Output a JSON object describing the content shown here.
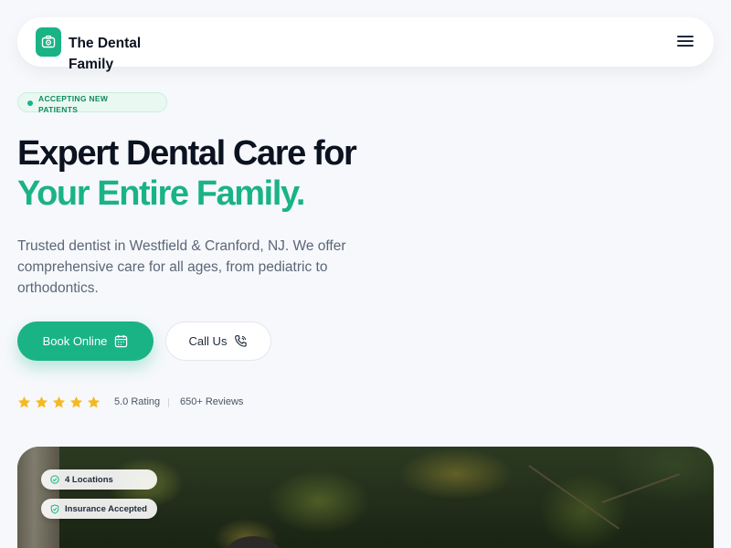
{
  "header": {
    "logo_text": "The Dental Family",
    "logo_icon": "camera-icon",
    "menu_icon": "hamburger-menu-icon"
  },
  "badge": {
    "text": "ACCEPTING NEW PATIENTS"
  },
  "hero": {
    "headline_line1": "Expert Dental Care for",
    "headline_line2": "Your Entire Family.",
    "subtext": "Trusted dentist in Westfield & Cranford, NJ. We offer comprehensive care for all ages, from pediatric to orthodontics."
  },
  "buttons": {
    "book_label": "Book Online",
    "book_icon": "calendar-icon",
    "call_label": "Call Us",
    "call_icon": "phone-icon"
  },
  "rating": {
    "stars": 5,
    "rating_text": "5.0 Rating",
    "reviews_text": "650+ Reviews"
  },
  "image_chips": {
    "locations": "4 Locations",
    "locations_icon": "check-circle-icon",
    "insurance": "Insurance Accepted",
    "insurance_icon": "shield-check-icon"
  },
  "colors": {
    "accent": "#1ab386",
    "star": "#f5b921",
    "heading": "#0b1220",
    "body_text": "#5b6678"
  }
}
